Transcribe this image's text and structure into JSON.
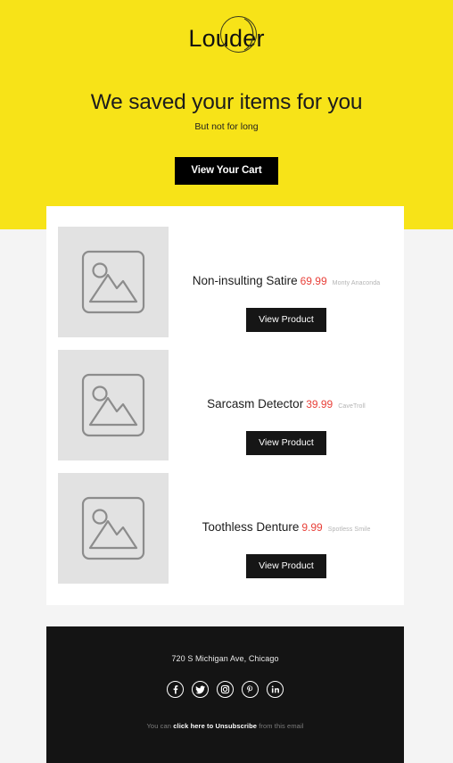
{
  "brand": {
    "logo_text": "Louder",
    "logo_mark": "circle-and-arc"
  },
  "hero": {
    "headline": "We saved your items for you",
    "subhead": "But not for long",
    "cta_label": "View Your Cart",
    "background_color": "#f7e318",
    "cta_background": "#000000",
    "cta_text_color": "#ffffff"
  },
  "products": [
    {
      "name": "Non-insulting Satire",
      "price": "69.99",
      "vendor": "Monty Anaconda",
      "button_label": "View Product",
      "image_placeholder": "image-placeholder-icon"
    },
    {
      "name": "Sarcasm Detector",
      "price": "39.99",
      "vendor": "CaveTroll",
      "button_label": "View Product",
      "image_placeholder": "image-placeholder-icon"
    },
    {
      "name": "Toothless Denture",
      "price": "9.99",
      "vendor": "Spotless Smile",
      "button_label": "View Product",
      "image_placeholder": "image-placeholder-icon"
    }
  ],
  "colors": {
    "price": "#e8413a",
    "vendor": "#b3b3b3",
    "card_background": "#ffffff",
    "page_background": "#f4f4f4",
    "footer_background": "#141414"
  },
  "footer": {
    "address": "720 S Michigan Ave, Chicago",
    "social": [
      {
        "name": "facebook-icon",
        "label": "f"
      },
      {
        "name": "twitter-icon",
        "label": "t"
      },
      {
        "name": "instagram-icon",
        "label": "ig"
      },
      {
        "name": "pinterest-icon",
        "label": "p"
      },
      {
        "name": "linkedin-icon",
        "label": "in"
      }
    ],
    "note_prefix": "You can ",
    "note_link": "click here to Unsubscribe",
    "note_suffix": " from this email"
  }
}
